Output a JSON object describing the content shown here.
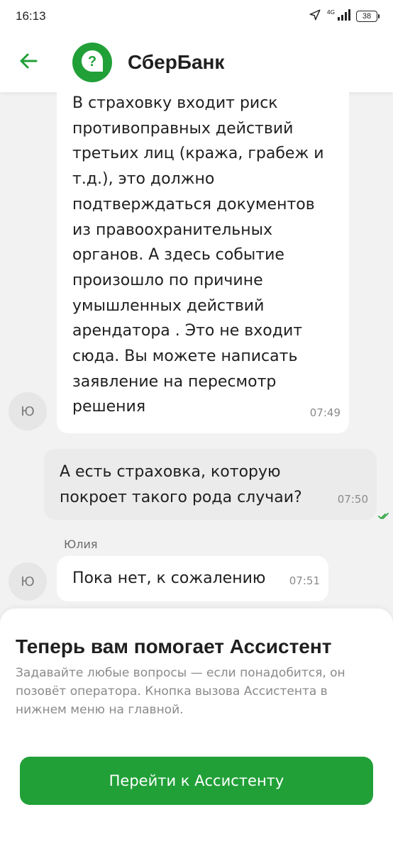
{
  "status_bar": {
    "time": "16:13",
    "network": "4G",
    "battery": "38",
    "icons": [
      "location-arrow-icon",
      "signal-icon",
      "battery-icon"
    ]
  },
  "header": {
    "title": "СберБанк",
    "back_icon": "arrow-left-icon",
    "logo_icon": "question-bubble-icon",
    "logo_color": "#21a038"
  },
  "messages": [
    {
      "direction": "incoming",
      "text": "В страховку входит риск\nпротивоправных действий\nтретьих лиц (кража, грабеж и\nт.д.), это должно\nподтверждаться документов\nиз правоохранительных\nорганов. А здесь событие\nпроизошло по причине\nумышленных действий\nарендатора . Это не входит\nсюда. Вы можете написать\nзаявление на пересмотр\nрешения",
      "time": "07:49",
      "avatar_initial": "Ю"
    },
    {
      "direction": "outgoing",
      "text": "А есть страховка, которую\nпокроет такого рода случаи?",
      "time": "07:50",
      "status_icon": "double-check-icon"
    },
    {
      "direction": "incoming",
      "sender": "Юлия",
      "text": "Пока нет, к сожалению",
      "time": "07:51",
      "avatar_initial": "Ю"
    }
  ],
  "assistant_sheet": {
    "title": "Теперь вам помогает Ассистент",
    "text": "Задавайте любые вопросы — если понадобится, он позовёт оператора. Кнопка вызова Ассистента в нижнем меню на главной.",
    "button_label": "Перейти к Ассистенту"
  },
  "colors": {
    "accent": "#21a038",
    "chat_background": "#f2f2f2",
    "outgoing_bubble": "#ebebeb",
    "incoming_bubble": "#ffffff"
  }
}
